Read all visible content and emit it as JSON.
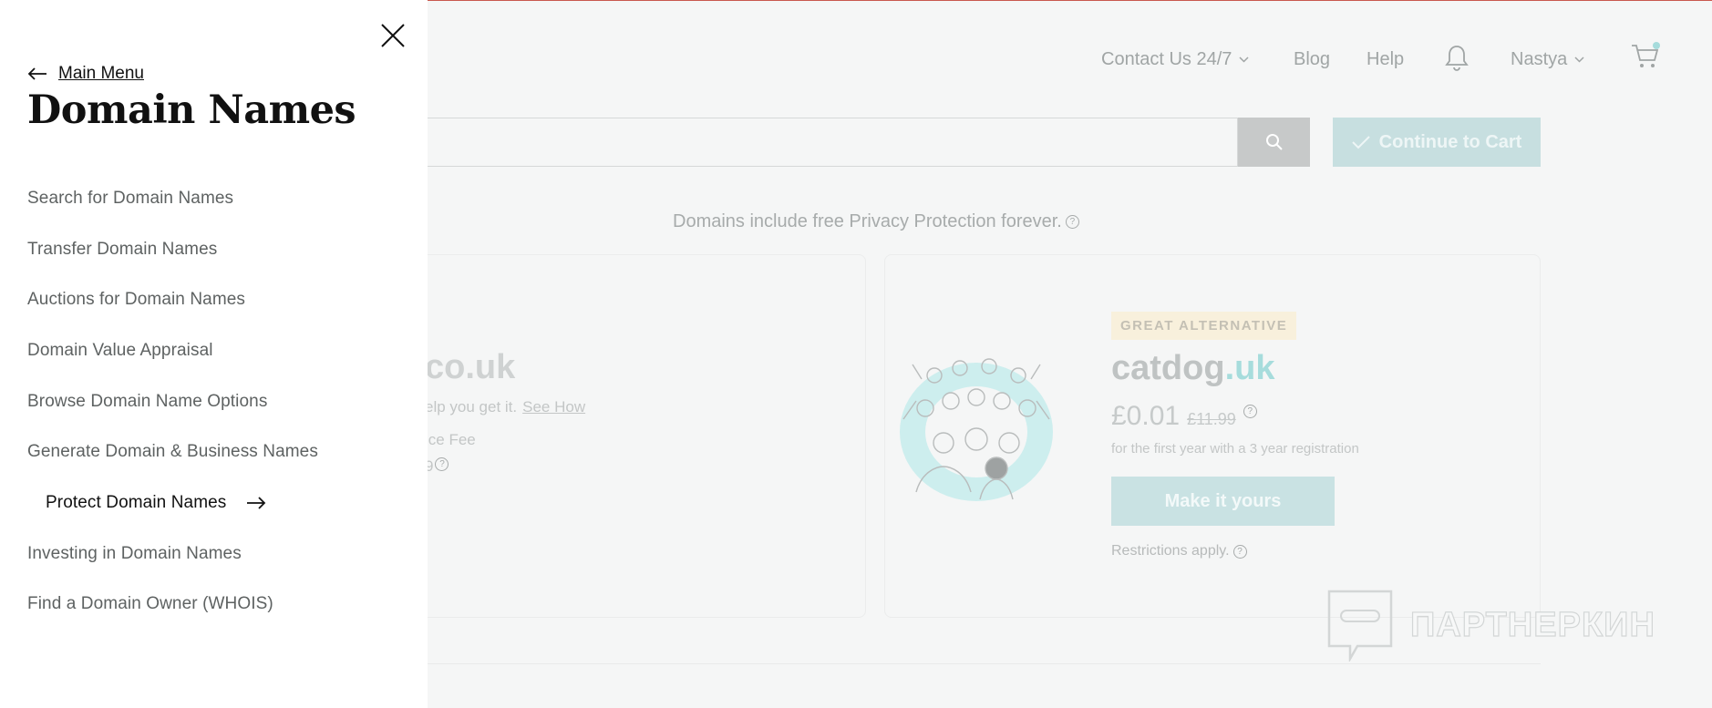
{
  "header": {
    "contact": "Contact Us 24/7",
    "blog": "Blog",
    "help": "Help",
    "user": "Nastya"
  },
  "search": {
    "continue_label": "Continue to Cart"
  },
  "privacy_note": "Domains include free Privacy Protection forever.",
  "left_card": {
    "domain_fragment": "co.uk",
    "line1": "elp you get it.",
    "see_how": "See How",
    "line2": "ice Fee",
    "line3": "9"
  },
  "right_card": {
    "badge": "GREAT ALTERNATIVE",
    "domain_base": "catdog",
    "domain_tld": ".uk",
    "price_new": "£0.01",
    "price_old": "£11.99",
    "first_year": "for the first year with a 3 year registration",
    "cta": "Make it yours",
    "restrictions": "Restrictions apply."
  },
  "watermark": "ПАРТНЕРКИН",
  "drawer": {
    "back_label": "Main Menu",
    "title": "Domain Names",
    "items": [
      {
        "label": "Search for Domain Names"
      },
      {
        "label": "Transfer Domain Names"
      },
      {
        "label": "Auctions for Domain Names"
      },
      {
        "label": "Domain Value Appraisal"
      },
      {
        "label": "Browse Domain Name Options"
      },
      {
        "label": "Generate Domain & Business Names"
      },
      {
        "label": "Protect Domain Names"
      },
      {
        "label": "Investing in Domain Names"
      },
      {
        "label": "Find a Domain Owner (WHOIS)"
      }
    ],
    "active_index": 6
  },
  "colors": {
    "accent_teal": "#a6dcdc",
    "top_line": "#c9584f"
  },
  "icons": [
    "close-icon",
    "arrow-left-icon",
    "arrow-right-icon",
    "search-icon",
    "check-icon",
    "bell-icon",
    "cart-icon",
    "chevron-down-icon",
    "help-circle-icon"
  ]
}
